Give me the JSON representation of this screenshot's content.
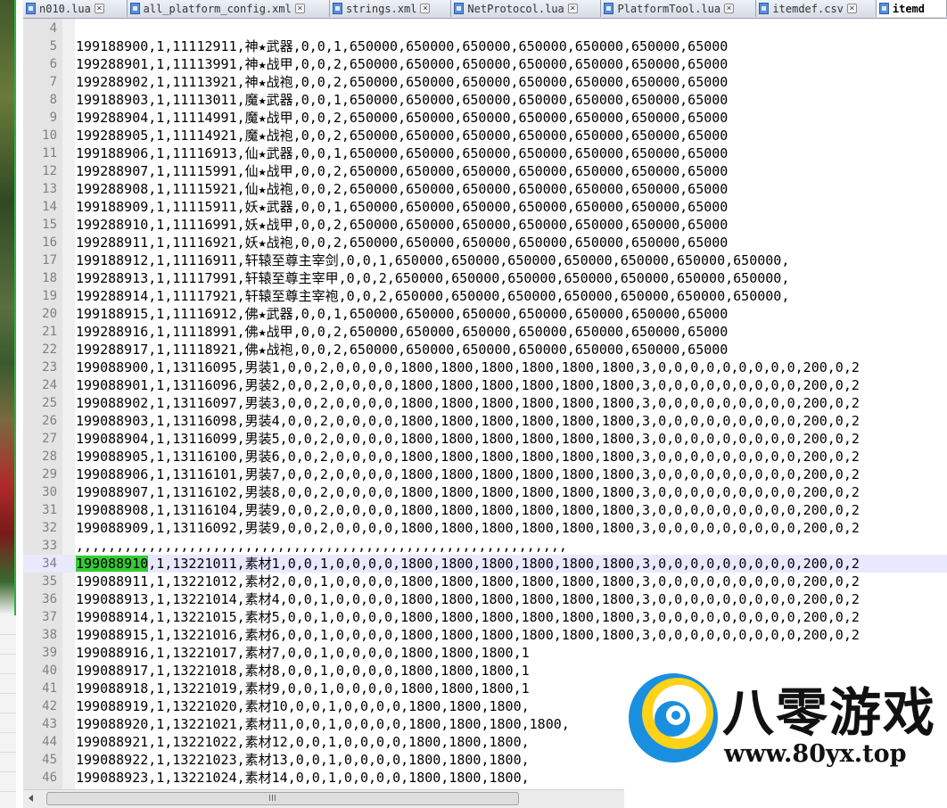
{
  "tabs": [
    {
      "label": "n010.lua",
      "width": 118
    },
    {
      "label": "all_platform_config.xml",
      "width": 230
    },
    {
      "label": "strings.xml",
      "width": 138
    },
    {
      "label": "NetProtocol.lua",
      "width": 170
    },
    {
      "label": "PlatformTool.lua",
      "width": 176
    },
    {
      "label": "itemdef.csv",
      "width": 136
    },
    {
      "label": "itemd",
      "width": 80,
      "active": true
    }
  ],
  "editor": {
    "lines": [
      {
        "n": "4",
        "text": ""
      },
      {
        "n": "5",
        "text": "199188900,1,11112911,神★武器,0,0,1,650000,650000,650000,650000,650000,650000,65000"
      },
      {
        "n": "6",
        "text": "199288901,1,11113991,神★战甲,0,0,2,650000,650000,650000,650000,650000,650000,65000"
      },
      {
        "n": "7",
        "text": "199288902,1,11113921,神★战袍,0,0,2,650000,650000,650000,650000,650000,650000,65000"
      },
      {
        "n": "8",
        "text": "199188903,1,11113011,魔★武器,0,0,1,650000,650000,650000,650000,650000,650000,65000"
      },
      {
        "n": "9",
        "text": "199288904,1,11114991,魔★战甲,0,0,2,650000,650000,650000,650000,650000,650000,65000"
      },
      {
        "n": "10",
        "text": "199288905,1,11114921,魔★战袍,0,0,2,650000,650000,650000,650000,650000,650000,65000"
      },
      {
        "n": "11",
        "text": "199188906,1,11116913,仙★武器,0,0,1,650000,650000,650000,650000,650000,650000,65000"
      },
      {
        "n": "12",
        "text": "199288907,1,11115991,仙★战甲,0,0,2,650000,650000,650000,650000,650000,650000,65000"
      },
      {
        "n": "13",
        "text": "199288908,1,11115921,仙★战袍,0,0,2,650000,650000,650000,650000,650000,650000,65000"
      },
      {
        "n": "14",
        "text": "199188909,1,11115911,妖★武器,0,0,1,650000,650000,650000,650000,650000,650000,65000"
      },
      {
        "n": "15",
        "text": "199288910,1,11116991,妖★战甲,0,0,2,650000,650000,650000,650000,650000,650000,65000"
      },
      {
        "n": "16",
        "text": "199288911,1,11116921,妖★战袍,0,0,2,650000,650000,650000,650000,650000,650000,65000"
      },
      {
        "n": "17",
        "text": "199188912,1,11116911,轩辕至尊主宰剑,0,0,1,650000,650000,650000,650000,650000,650000,650000,"
      },
      {
        "n": "18",
        "text": "199288913,1,11117991,轩辕至尊主宰甲,0,0,2,650000,650000,650000,650000,650000,650000,650000,"
      },
      {
        "n": "19",
        "text": "199288914,1,11117921,轩辕至尊主宰袍,0,0,2,650000,650000,650000,650000,650000,650000,650000,"
      },
      {
        "n": "20",
        "text": "199188915,1,11116912,佛★武器,0,0,1,650000,650000,650000,650000,650000,650000,65000"
      },
      {
        "n": "21",
        "text": "199288916,1,11118991,佛★战甲,0,0,2,650000,650000,650000,650000,650000,650000,65000"
      },
      {
        "n": "22",
        "text": "199288917,1,11118921,佛★战袍,0,0,2,650000,650000,650000,650000,650000,650000,65000"
      },
      {
        "n": "23",
        "text": "199088900,1,13116095,男装1,0,0,2,0,0,0,0,1800,1800,1800,1800,1800,1800,3,0,0,0,0,0,0,0,0,0,200,0,2"
      },
      {
        "n": "24",
        "text": "199088901,1,13116096,男装2,0,0,2,0,0,0,0,1800,1800,1800,1800,1800,1800,3,0,0,0,0,0,0,0,0,0,200,0,2"
      },
      {
        "n": "25",
        "text": "199088902,1,13116097,男装3,0,0,2,0,0,0,0,1800,1800,1800,1800,1800,1800,3,0,0,0,0,0,0,0,0,0,200,0,2"
      },
      {
        "n": "26",
        "text": "199088903,1,13116098,男装4,0,0,2,0,0,0,0,1800,1800,1800,1800,1800,1800,3,0,0,0,0,0,0,0,0,0,200,0,2"
      },
      {
        "n": "27",
        "text": "199088904,1,13116099,男装5,0,0,2,0,0,0,0,1800,1800,1800,1800,1800,1800,3,0,0,0,0,0,0,0,0,0,200,0,2"
      },
      {
        "n": "28",
        "text": "199088905,1,13116100,男装6,0,0,2,0,0,0,0,1800,1800,1800,1800,1800,1800,3,0,0,0,0,0,0,0,0,0,200,0,2"
      },
      {
        "n": "29",
        "text": "199088906,1,13116101,男装7,0,0,2,0,0,0,0,1800,1800,1800,1800,1800,1800,3,0,0,0,0,0,0,0,0,0,200,0,2"
      },
      {
        "n": "30",
        "text": "199088907,1,13116102,男装8,0,0,2,0,0,0,0,1800,1800,1800,1800,1800,1800,3,0,0,0,0,0,0,0,0,0,200,0,2"
      },
      {
        "n": "31",
        "text": "199088908,1,13116104,男装9,0,0,2,0,0,0,0,1800,1800,1800,1800,1800,1800,3,0,0,0,0,0,0,0,0,0,200,0,2"
      },
      {
        "n": "32",
        "text": "199088909,1,13116092,男装9,0,0,2,0,0,0,0,1800,1800,1800,1800,1800,1800,3,0,0,0,0,0,0,0,0,0,200,0,2"
      },
      {
        "n": "33",
        "text": ",,,,,,,,,,,,,,,,,,,,,,,,,,,,,,,,,,,,,,,,,,,,,,,,,,,,,,,,,,,,,"
      },
      {
        "n": "34",
        "text": ",1,13221011,素材1,0,0,1,0,0,0,0,1800,1800,1800,1800,1800,1800,3,0,0,0,0,0,0,0,0,0,200,0,2",
        "highlight": "199088910",
        "current": true
      },
      {
        "n": "35",
        "text": "199088911,1,13221012,素材2,0,0,1,0,0,0,0,1800,1800,1800,1800,1800,1800,3,0,0,0,0,0,0,0,0,0,200,0,2"
      },
      {
        "n": "36",
        "text": "199088913,1,13221014,素材4,0,0,1,0,0,0,0,1800,1800,1800,1800,1800,1800,3,0,0,0,0,0,0,0,0,0,200,0,2"
      },
      {
        "n": "37",
        "text": "199088914,1,13221015,素材5,0,0,1,0,0,0,0,1800,1800,1800,1800,1800,1800,3,0,0,0,0,0,0,0,0,0,200,0,2"
      },
      {
        "n": "38",
        "text": "199088915,1,13221016,素材6,0,0,1,0,0,0,0,1800,1800,1800,1800,1800,1800,3,0,0,0,0,0,0,0,0,0,200,0,2"
      },
      {
        "n": "39",
        "text": "199088916,1,13221017,素材7,0,0,1,0,0,0,0,1800,1800,1800,1"
      },
      {
        "n": "40",
        "text": "199088917,1,13221018,素材8,0,0,1,0,0,0,0,1800,1800,1800,1"
      },
      {
        "n": "41",
        "text": "199088918,1,13221019,素材9,0,0,1,0,0,0,0,1800,1800,1800,1"
      },
      {
        "n": "42",
        "text": "199088919,1,13221020,素材10,0,0,1,0,0,0,0,1800,1800,1800,"
      },
      {
        "n": "43",
        "text": "199088920,1,13221021,素材11,0,0,1,0,0,0,0,1800,1800,1800,1800,"
      },
      {
        "n": "44",
        "text": "199088921,1,13221022,素材12,0,0,1,0,0,0,0,1800,1800,1800,"
      },
      {
        "n": "45",
        "text": "199088922,1,13221023,素材13,0,0,1,0,0,0,0,1800,1800,1800,"
      },
      {
        "n": "46",
        "text": "199088923,1,13221024,素材14,0,0,1,0,0,0,0,1800,1800,1800,"
      }
    ]
  },
  "scrollbar": {
    "grip": "III"
  },
  "watermark": {
    "title": "八零游戏",
    "url": "www.80yx.top"
  },
  "colors": {
    "selection": "#33cc33",
    "current_line": "#e8e8ff",
    "gutter": "#e4e4e4"
  }
}
